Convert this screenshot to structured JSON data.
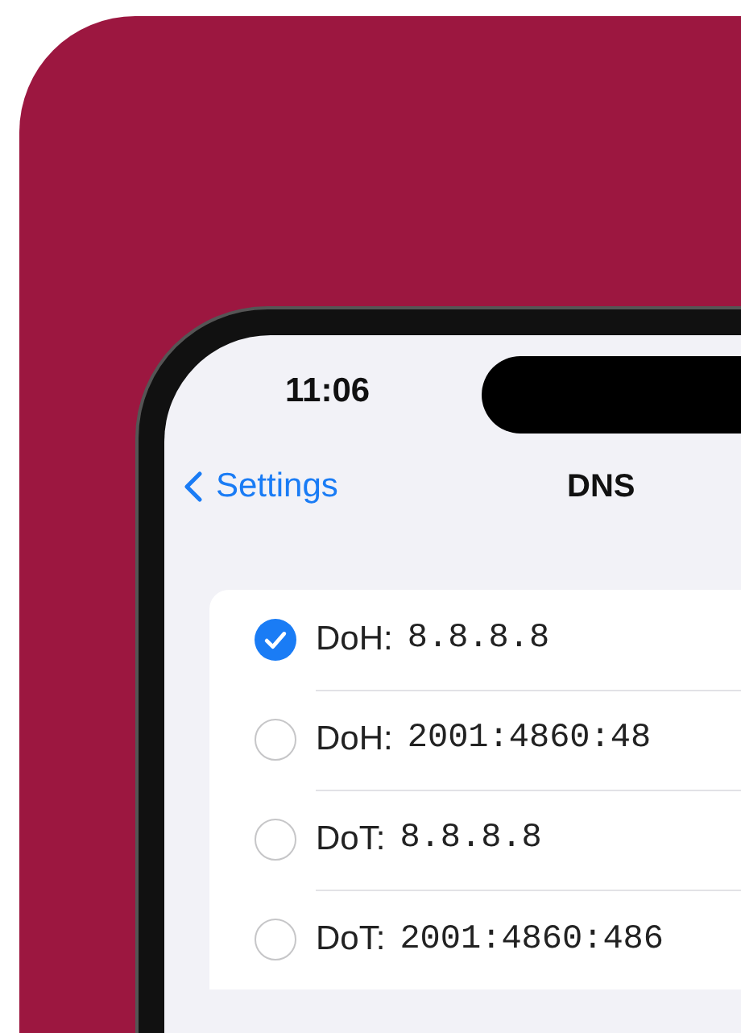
{
  "status_bar": {
    "time": "11:06"
  },
  "nav": {
    "back": "Settings",
    "title": "DNS"
  },
  "servers": [
    {
      "protocol": "DoH:",
      "address": "8.8.8.8",
      "selected": true
    },
    {
      "protocol": "DoH:",
      "address": "2001:4860:48",
      "selected": false
    },
    {
      "protocol": "DoT:",
      "address": "8.8.8.8",
      "selected": false
    },
    {
      "protocol": "DoT:",
      "address": "2001:4860:486",
      "selected": false
    }
  ]
}
